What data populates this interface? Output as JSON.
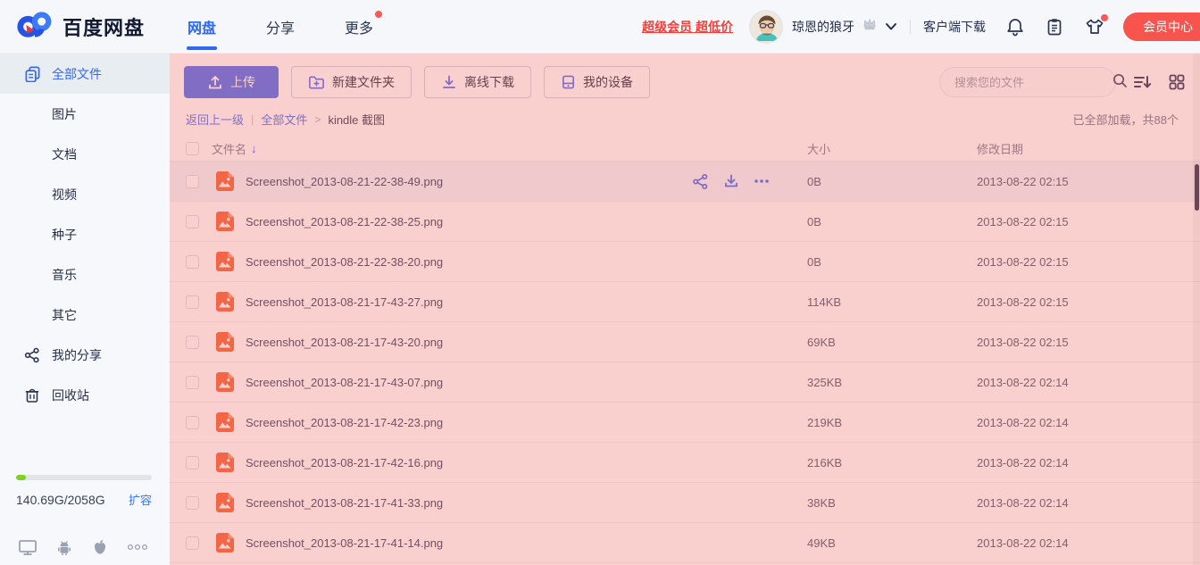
{
  "header": {
    "brand": "百度网盘",
    "tabs": [
      {
        "label": "网盘",
        "active": true
      },
      {
        "label": "分享",
        "active": false
      },
      {
        "label": "更多",
        "active": false,
        "badge": true
      }
    ],
    "promo": "超级会员 超低价",
    "username": "琼恩的狼牙",
    "client_download": "客户端下载",
    "vip_center": "会员中心"
  },
  "sidebar": {
    "items": [
      {
        "label": "全部文件",
        "active": true
      },
      {
        "label": "图片"
      },
      {
        "label": "文档"
      },
      {
        "label": "视频"
      },
      {
        "label": "种子"
      },
      {
        "label": "音乐"
      },
      {
        "label": "其它"
      },
      {
        "label": "我的分享"
      },
      {
        "label": "回收站"
      }
    ],
    "storage": {
      "usage": "140.69G/2058G",
      "expand": "扩容",
      "percent_used": 7
    }
  },
  "toolbar": {
    "upload": "上传",
    "new_folder": "新建文件夹",
    "offline_download": "离线下载",
    "my_devices": "我的设备",
    "search_placeholder": "搜索您的文件"
  },
  "breadcrumb": {
    "back": "返回上一级",
    "root": "全部文件",
    "current": "kindle 截图",
    "load_status": "已全部加载，共88个"
  },
  "files": {
    "columns": {
      "name": "文件名",
      "size": "大小",
      "date": "修改日期"
    },
    "rows": [
      {
        "name": "Screenshot_2013-08-21-22-38-49.png",
        "size": "0B",
        "date": "2013-08-22 02:15",
        "active": true
      },
      {
        "name": "Screenshot_2013-08-21-22-38-25.png",
        "size": "0B",
        "date": "2013-08-22 02:15"
      },
      {
        "name": "Screenshot_2013-08-21-22-38-20.png",
        "size": "0B",
        "date": "2013-08-22 02:15"
      },
      {
        "name": "Screenshot_2013-08-21-17-43-27.png",
        "size": "114KB",
        "date": "2013-08-22 02:15"
      },
      {
        "name": "Screenshot_2013-08-21-17-43-20.png",
        "size": "69KB",
        "date": "2013-08-22 02:15"
      },
      {
        "name": "Screenshot_2013-08-21-17-43-07.png",
        "size": "325KB",
        "date": "2013-08-22 02:14"
      },
      {
        "name": "Screenshot_2013-08-21-17-42-23.png",
        "size": "219KB",
        "date": "2013-08-22 02:14"
      },
      {
        "name": "Screenshot_2013-08-21-17-42-16.png",
        "size": "216KB",
        "date": "2013-08-22 02:14"
      },
      {
        "name": "Screenshot_2013-08-21-17-41-33.png",
        "size": "38KB",
        "date": "2013-08-22 02:14"
      },
      {
        "name": "Screenshot_2013-08-21-17-41-14.png",
        "size": "49KB",
        "date": "2013-08-22 02:14"
      }
    ]
  },
  "colors": {
    "accent_blue": "#3169F5",
    "button_blue": "#5272F0",
    "brand_red": "#F6544D",
    "file_icon_orange": "#F4683C",
    "content_overlay": "rgba(240,98,94,0.30)",
    "storage_green": "#7ED321"
  }
}
